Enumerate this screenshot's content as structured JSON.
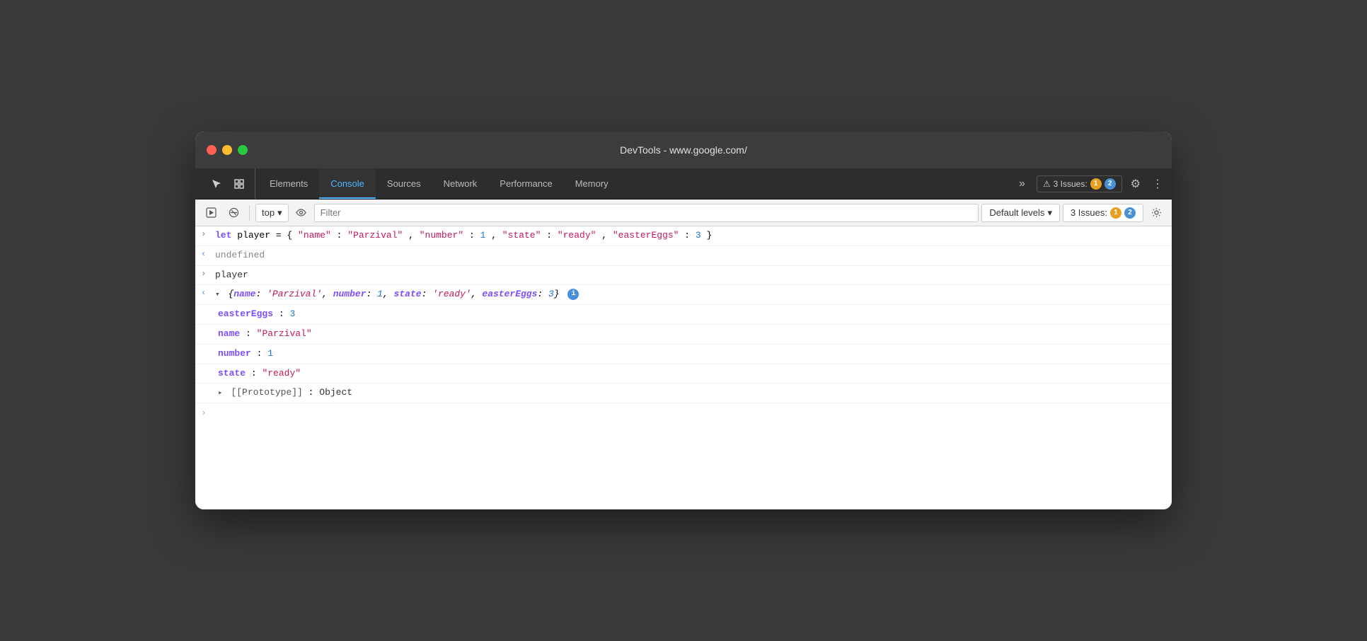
{
  "window": {
    "title": "DevTools - www.google.com/"
  },
  "tabs": {
    "items": [
      {
        "id": "elements",
        "label": "Elements",
        "active": false
      },
      {
        "id": "console",
        "label": "Console",
        "active": true
      },
      {
        "id": "sources",
        "label": "Sources",
        "active": false
      },
      {
        "id": "network",
        "label": "Network",
        "active": false
      },
      {
        "id": "performance",
        "label": "Performance",
        "active": false
      },
      {
        "id": "memory",
        "label": "Memory",
        "active": false
      }
    ],
    "more_label": "»",
    "issues_label": "3 Issues:",
    "issues_warning_count": "1",
    "issues_info_count": "2"
  },
  "toolbar": {
    "context_label": "top",
    "filter_placeholder": "Filter",
    "levels_label": "Default levels"
  },
  "console": {
    "lines": [
      {
        "type": "input",
        "content": "let player = { \"name\": \"Parzival\", \"number\": 1, \"state\": \"ready\", \"easterEggs\": 3 }"
      },
      {
        "type": "output",
        "content": "undefined"
      },
      {
        "type": "input-ref",
        "content": "player"
      },
      {
        "type": "object-expanded",
        "summary": "{name: 'Parzival', number: 1, state: 'ready', easterEggs: 3}",
        "properties": [
          {
            "key": "easterEggs",
            "value": "3",
            "type": "number"
          },
          {
            "key": "name",
            "value": "\"Parzival\"",
            "type": "string"
          },
          {
            "key": "number",
            "value": "1",
            "type": "number"
          },
          {
            "key": "state",
            "value": "\"ready\"",
            "type": "string"
          }
        ],
        "prototype": "[[Prototype]]: Object"
      }
    ]
  },
  "icons": {
    "cursor": "↖",
    "inspect": "⬚",
    "play": "▶",
    "block": "⊘",
    "eye": "👁",
    "chevron_down": "▾",
    "gear": "⚙",
    "dots": "⋮",
    "warning": "⚠",
    "info": "i",
    "right_arrow": ">",
    "left_arrow": "<",
    "expand_arrow": "▸",
    "collapse_arrow": "▾"
  }
}
